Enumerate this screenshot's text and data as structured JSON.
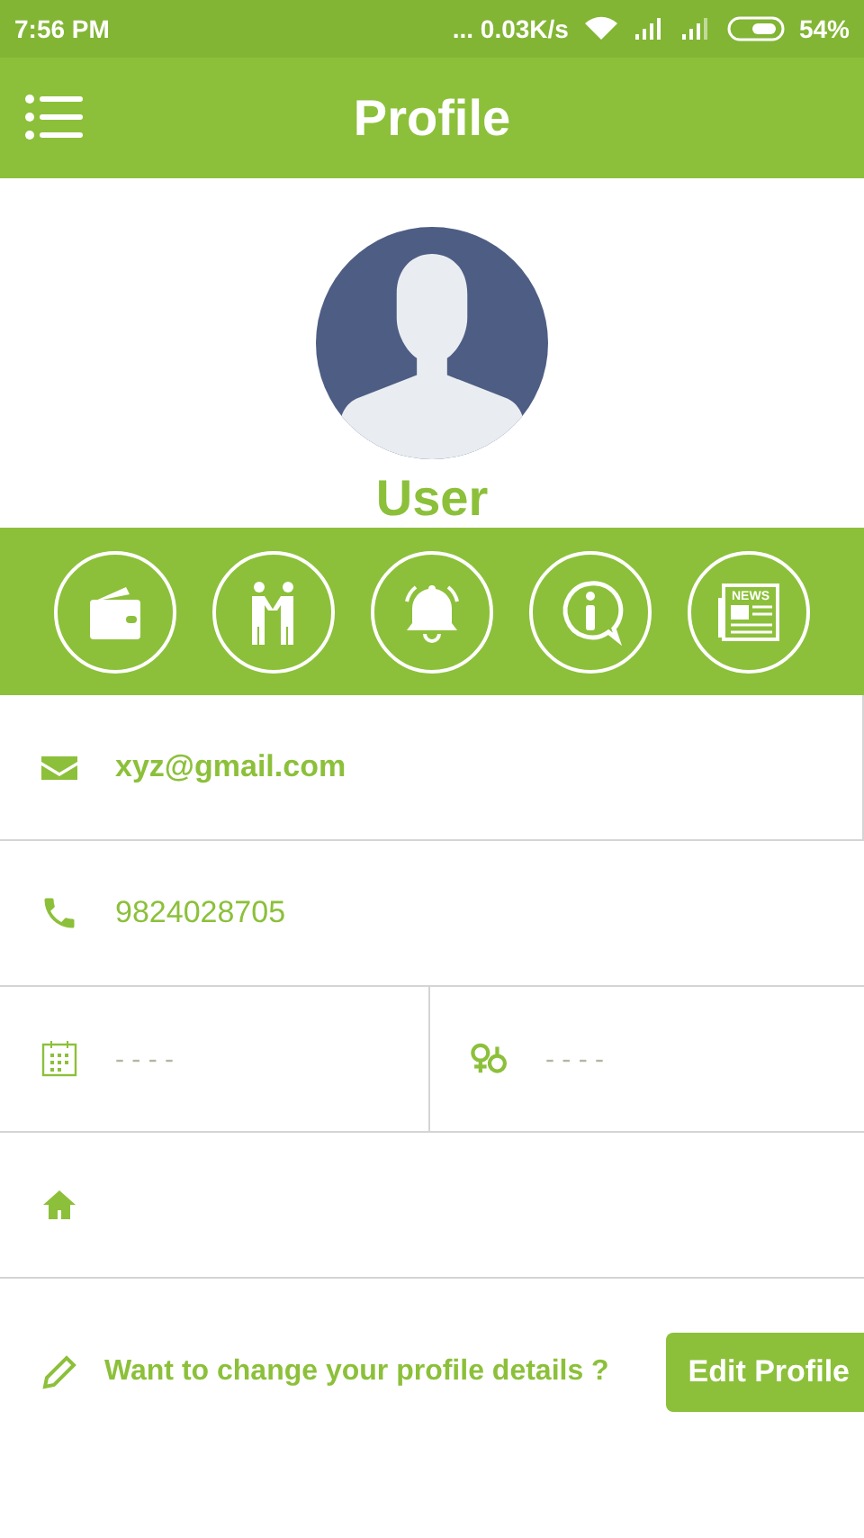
{
  "status_bar": {
    "time": "7:56 PM",
    "network_speed": "... 0.03K/s",
    "battery": "54%"
  },
  "app_bar": {
    "title": "Profile"
  },
  "profile": {
    "name": "User"
  },
  "shortcuts": [
    {
      "kind": "wallet"
    },
    {
      "kind": "handshake"
    },
    {
      "kind": "bell"
    },
    {
      "kind": "info"
    },
    {
      "kind": "news",
      "text": "NEWS"
    }
  ],
  "fields": [
    {
      "kind": "email",
      "value": "xyz@gmail.com"
    },
    {
      "kind": "phone",
      "value": "9824028705"
    },
    {
      "kind": "dob",
      "value": "- - - -"
    },
    {
      "kind": "gender",
      "value": "- - - -"
    },
    {
      "kind": "address"
    }
  ],
  "footer": {
    "prompt": "Want to change your profile details ?",
    "button": "Edit Profile"
  }
}
